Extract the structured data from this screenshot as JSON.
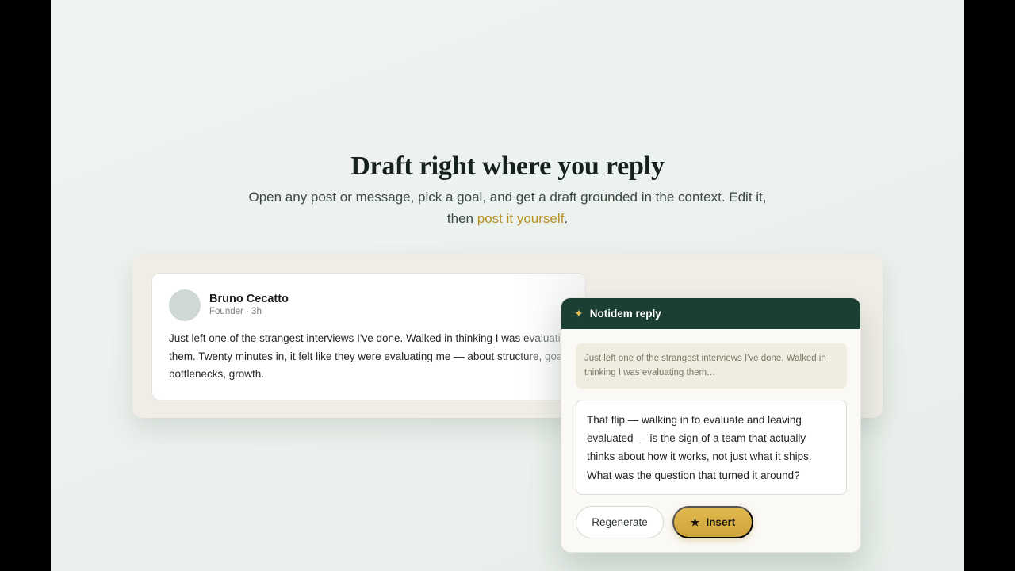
{
  "hero": {
    "title": "Draft right where you reply",
    "subtitle_before": "Open any post or message, pick a goal, and get a draft grounded in the context. Edit it, then ",
    "subtitle_link": "post it yourself",
    "subtitle_after": "."
  },
  "post": {
    "author": "Bruno Cecatto",
    "meta": "Founder · 3h",
    "body": "Just left one of the strangest interviews I've done. Walked in thinking I was evaluating them. Twenty minutes in, it felt like they were evaluating me — about structure, goals, bottlenecks, growth."
  },
  "panel": {
    "title": "Notidem reply",
    "icon": "sparkle-icon",
    "quote": "Just left one of the strangest interviews I've done. Walked in thinking I was evaluating them…",
    "draft": "That flip — walking in to evaluate and leaving evaluated — is the sign of a team that actually thinks about how it works, not just what it ships. What was the question that turned it around?",
    "regenerate_label": "Regenerate",
    "insert_label": "Insert"
  },
  "colors": {
    "brand_dark": "#1c3f33",
    "accent_gold": "#b89028",
    "insert_gold": "#d6ad44"
  }
}
